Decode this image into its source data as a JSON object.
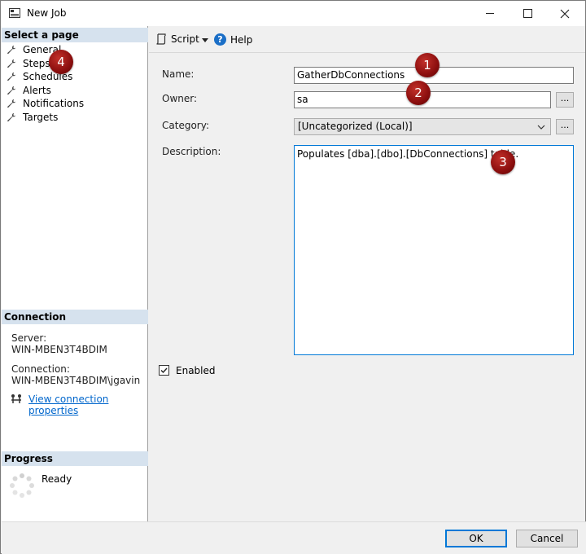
{
  "window": {
    "title": "New Job"
  },
  "left_pane": {
    "select_page_header": "Select a page",
    "pages": [
      {
        "label": "General"
      },
      {
        "label": "Steps"
      },
      {
        "label": "Schedules"
      },
      {
        "label": "Alerts"
      },
      {
        "label": "Notifications"
      },
      {
        "label": "Targets"
      }
    ],
    "connection": {
      "header": "Connection",
      "server_label": "Server:",
      "server_value": "WIN-MBEN3T4BDIM",
      "connection_label": "Connection:",
      "connection_value": "WIN-MBEN3T4BDIM\\jgavin",
      "view_properties_link": "View connection properties"
    },
    "progress": {
      "header": "Progress",
      "status": "Ready"
    }
  },
  "toolbar": {
    "script_label": "Script",
    "help_label": "Help"
  },
  "form": {
    "name_label": "Name:",
    "name_value": "GatherDbConnections",
    "owner_label": "Owner:",
    "owner_value": "sa",
    "category_label": "Category:",
    "category_value": "[Uncategorized (Local)]",
    "description_label": "Description:",
    "description_value": "Populates [dba].[dbo].[DbConnections] table.",
    "enabled_label": "Enabled",
    "enabled_checked": true,
    "ellipsis_label": "..."
  },
  "annotations": {
    "badge_1": "1",
    "badge_2": "2",
    "badge_3": "3",
    "badge_4": "4",
    "color": "#a01a1a"
  },
  "buttons": {
    "ok": "OK",
    "cancel": "Cancel"
  },
  "colors": {
    "section_header_bg": "#d6e2ee",
    "link": "#0066cc",
    "focus_border": "#0078d7"
  }
}
